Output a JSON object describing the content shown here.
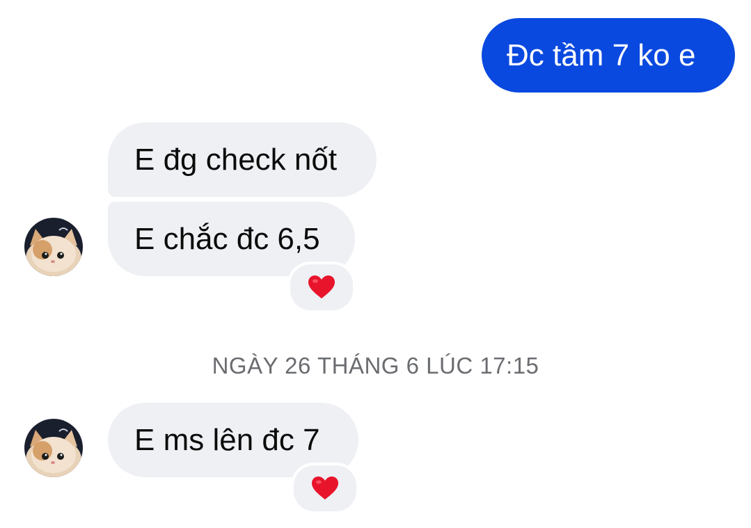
{
  "messages": {
    "outgoing_1": "Đc tầm 7 ko e",
    "incoming_1": "E đg check nốt",
    "incoming_2": "E chắc đc 6,5",
    "incoming_3": "E ms lên đc 7"
  },
  "timestamp": "NGÀY 26 THÁNG 6 LÚC 17:15",
  "reactions": {
    "incoming_2": "heart-icon",
    "incoming_3": "heart-icon"
  },
  "colors": {
    "outgoing_bubble": "#0a49e0",
    "incoming_bubble": "#eef0f4",
    "heart": "#e8142b",
    "timestamp_text": "#6a6c70"
  }
}
